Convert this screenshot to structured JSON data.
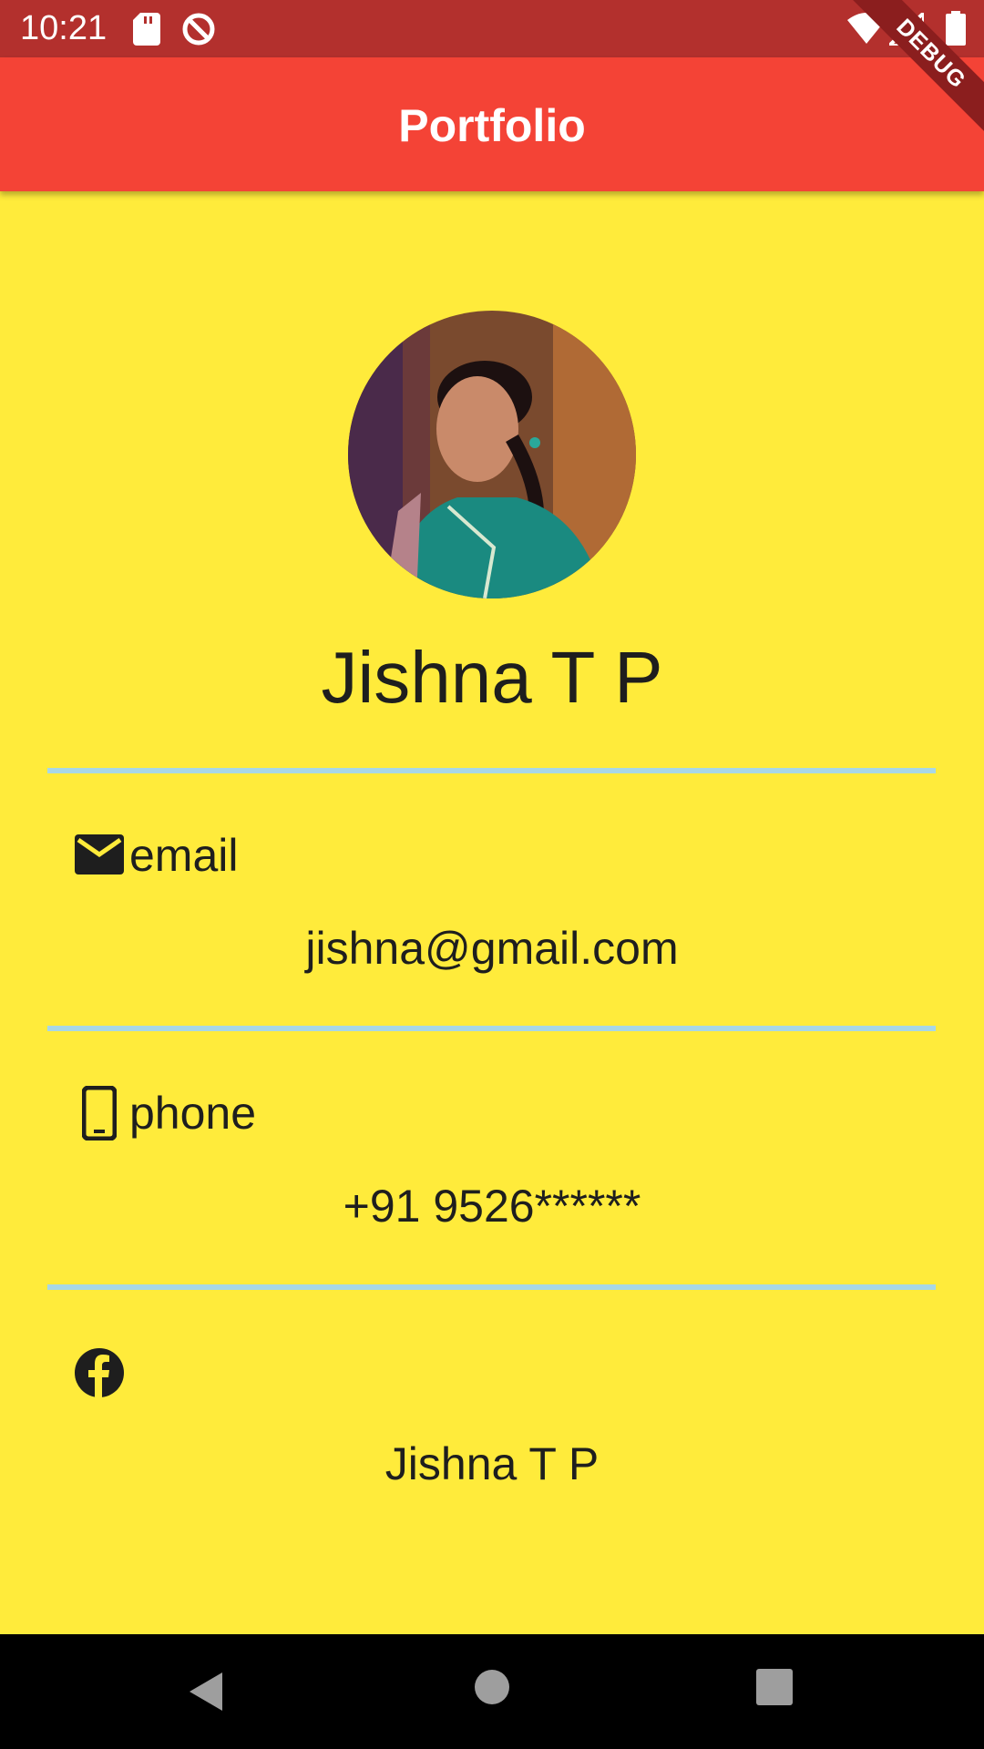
{
  "status_bar": {
    "time": "10:21",
    "background": "#B3302D"
  },
  "app_bar": {
    "title": "Portfolio",
    "background": "#F44336",
    "debug_label": "DEBUG"
  },
  "profile": {
    "name": "Jishna T P"
  },
  "contact": {
    "email": {
      "icon": "mail-icon",
      "label": "email",
      "value": "jishna@gmail.com"
    },
    "phone": {
      "icon": "phone-icon",
      "label": "phone",
      "value": "+91 9526******"
    },
    "facebook": {
      "icon": "facebook-icon",
      "value": "Jishna T P"
    }
  },
  "colors": {
    "page_background": "#FFEB3B",
    "divider": "#A8D7E6"
  }
}
